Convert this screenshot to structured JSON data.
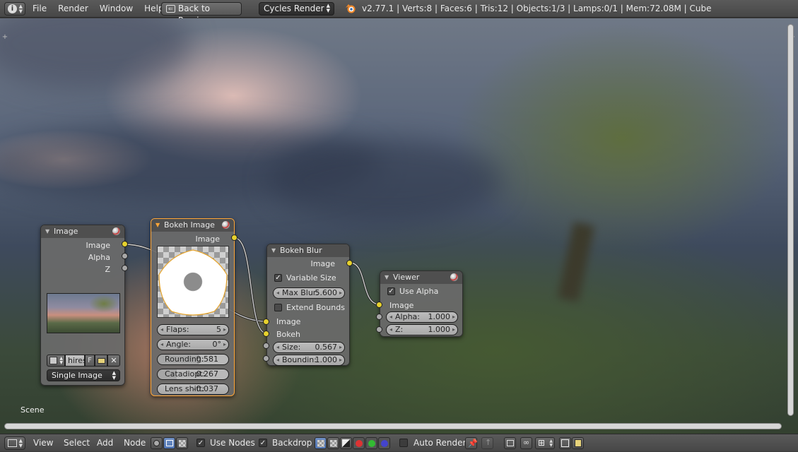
{
  "colors": {
    "accent_active": "#ffa637",
    "socket_image": "#e6d12e",
    "socket_value": "#a8a8a8"
  },
  "topbar": {
    "menus": [
      "File",
      "Render",
      "Window",
      "Help"
    ],
    "back_button": "Back to Previous",
    "render_engine": "Cycles Render",
    "status": "v2.77.1 | Verts:8 | Faces:6 | Tris:12 | Objects:1/3 | Lamps:0/1 | Mem:72.08M | Cube"
  },
  "editor": {
    "scene_label": "Scene"
  },
  "nodes": {
    "image": {
      "title": "Image",
      "outputs": [
        "Image",
        "Alpha",
        "Z"
      ],
      "file_name": "hires",
      "fake_user": "F",
      "source": "Single Image"
    },
    "bokeh_image": {
      "title": "Bokeh Image",
      "output": "Image",
      "fields": [
        {
          "label": "Flaps:",
          "value": "5"
        },
        {
          "label": "Angle:",
          "value": "0°"
        },
        {
          "label": "Rounding:",
          "value": "0.581"
        },
        {
          "label": "Catadiopt:",
          "value": "0.267"
        },
        {
          "label": "Lens shift:",
          "value": "-0.037"
        }
      ]
    },
    "bokeh_blur": {
      "title": "Bokeh Blur",
      "output": "Image",
      "variable_size": "Variable Size",
      "max_blur_label": "Max Blur:",
      "max_blur_value": "5.600",
      "extend_bounds": "Extend Bounds",
      "inputs": [
        "Image",
        "Bokeh"
      ],
      "size_label": "Size:",
      "size_value": "0.567",
      "bounding_label": "Boundin:",
      "bounding_value": "1.000"
    },
    "viewer": {
      "title": "Viewer",
      "use_alpha": "Use Alpha",
      "input": "Image",
      "alpha_label": "Alpha:",
      "alpha_value": "1.000",
      "z_label": "Z:",
      "z_value": "1.000"
    }
  },
  "bottombar": {
    "menus": [
      "View",
      "Select",
      "Add",
      "Node"
    ],
    "use_nodes": "Use Nodes",
    "backdrop": "Backdrop",
    "auto_render": "Auto Render"
  }
}
